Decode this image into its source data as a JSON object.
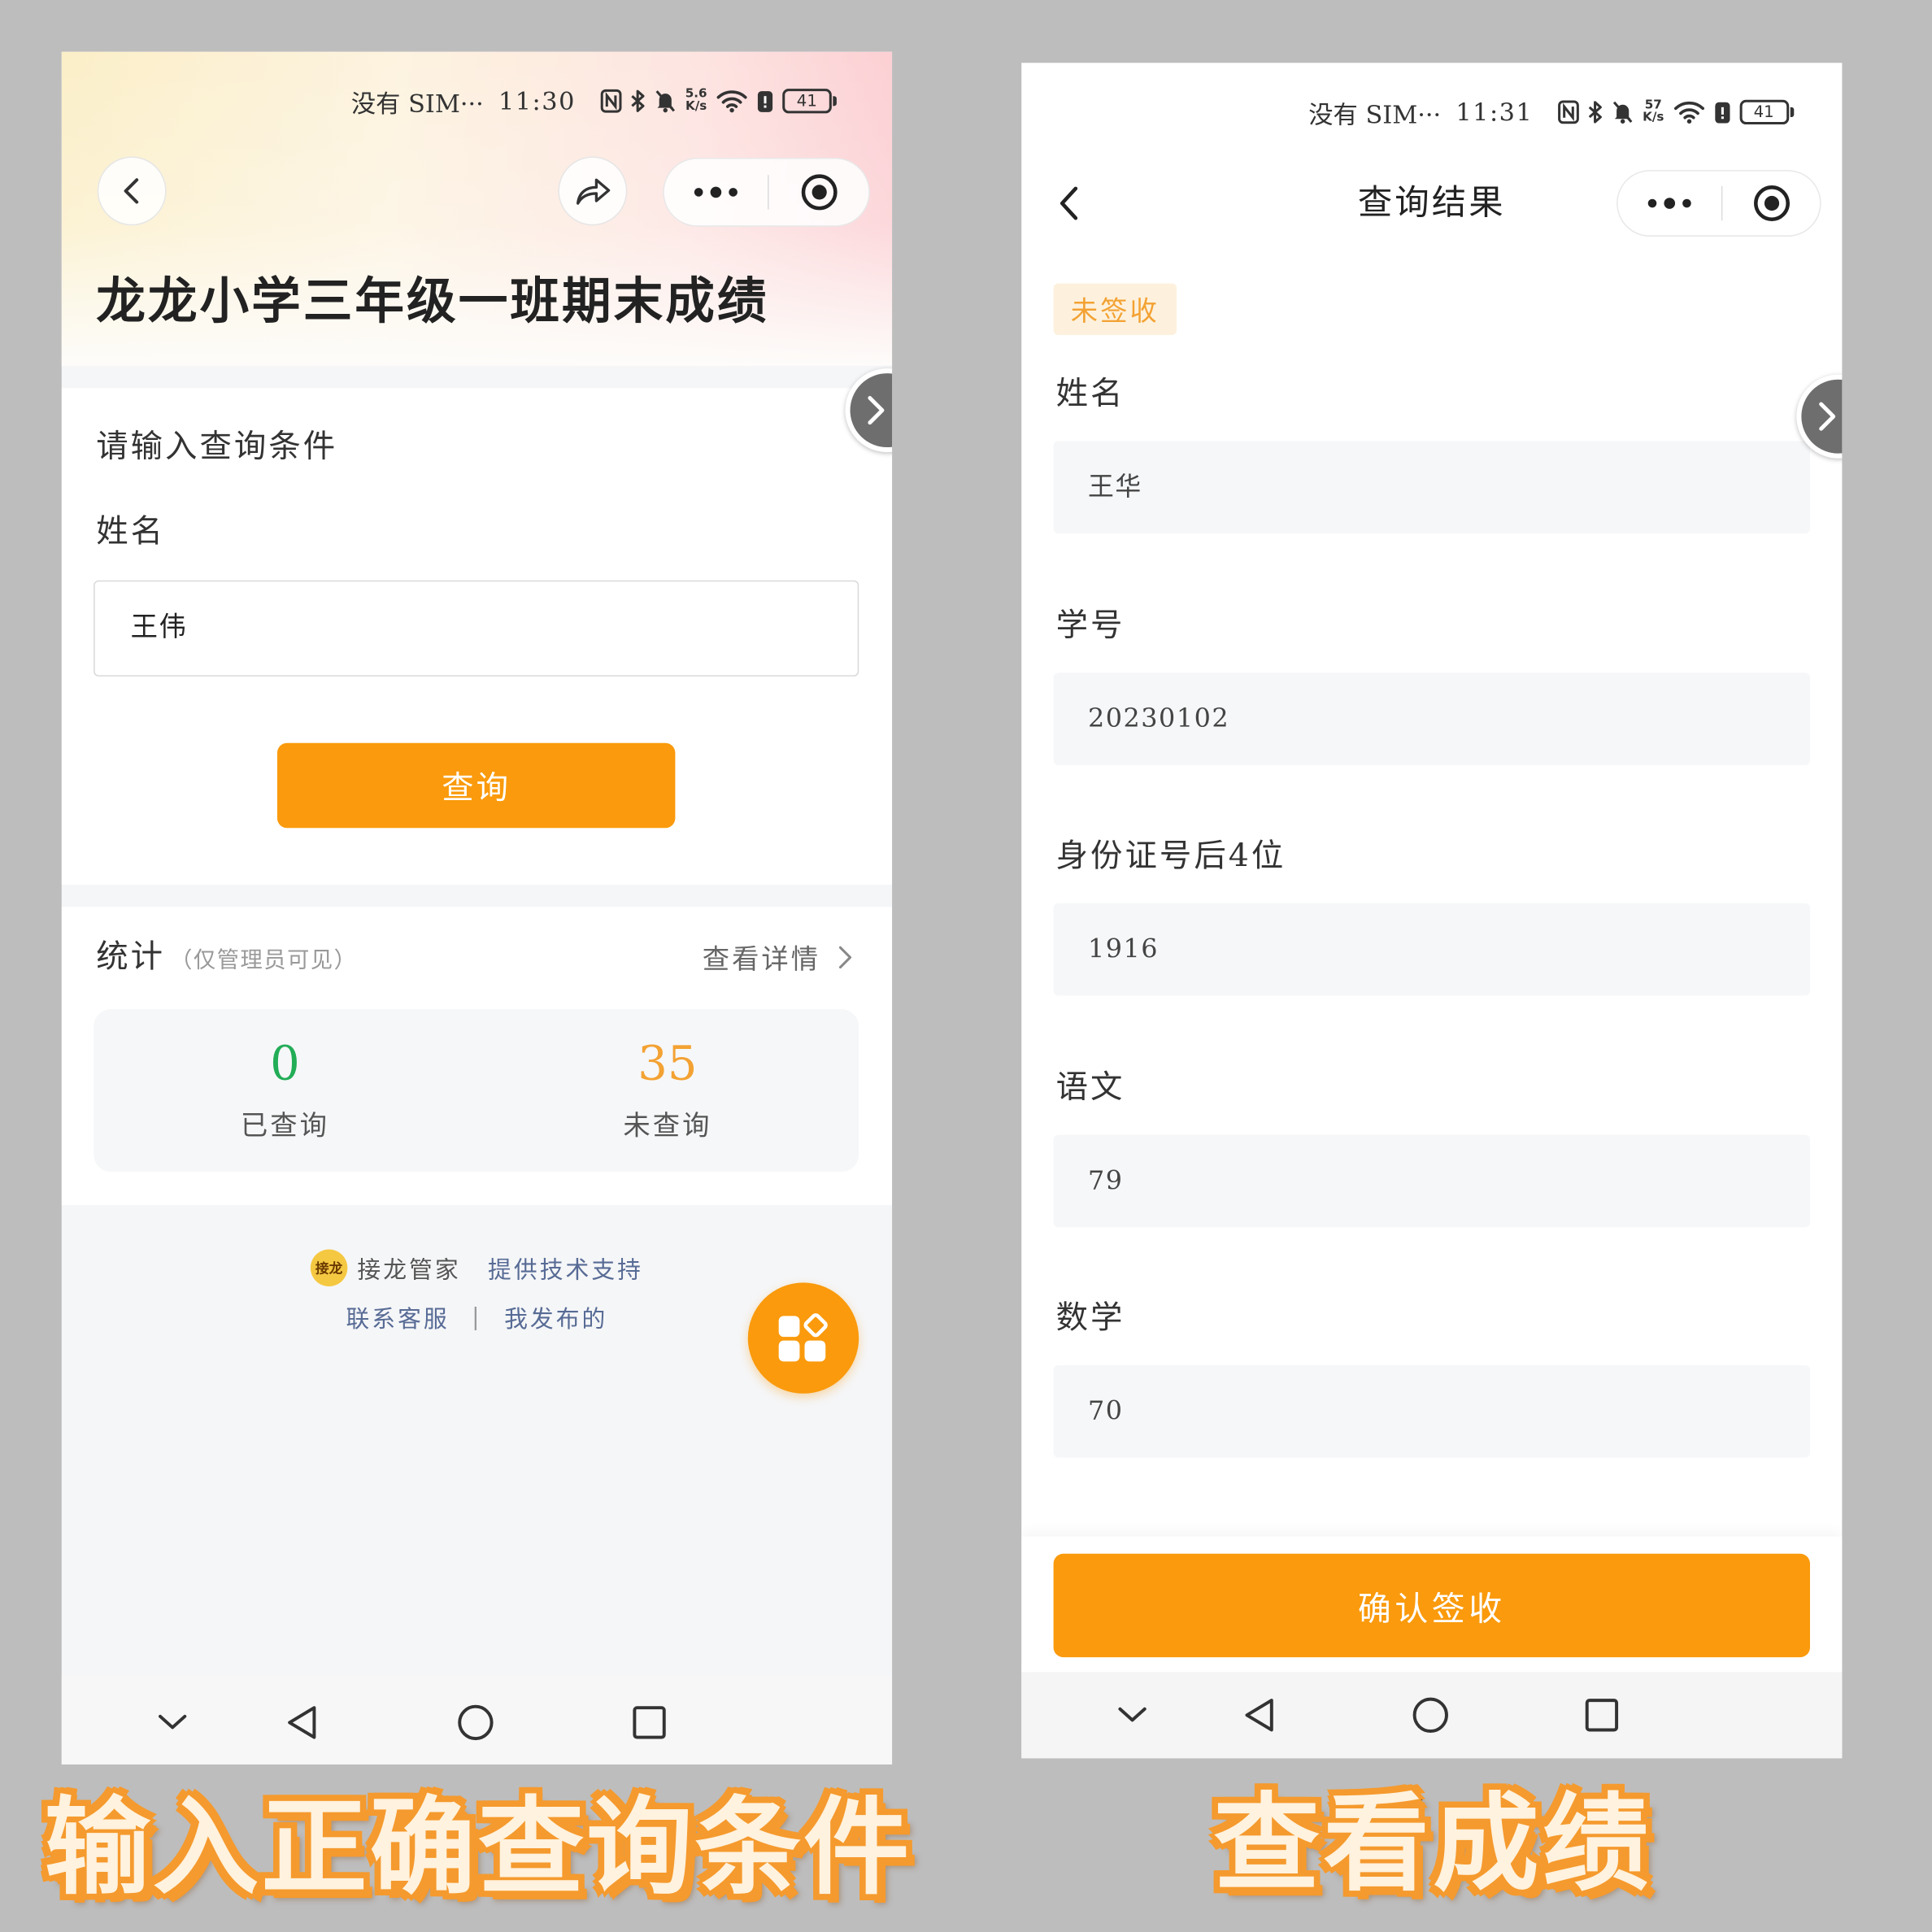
{
  "colors": {
    "page_background": "#bdbdbd",
    "accent": "#fa9a0c",
    "link": "#576b95",
    "queried_green": "#22ad57",
    "not_queried_orange": "#f3a233",
    "tag_background": "#fdf1de"
  },
  "left_screen": {
    "status_bar": {
      "carrier": "没有 SIM···",
      "time": "11:30",
      "speed_value": "5.6",
      "speed_unit": "K/s",
      "battery": "41",
      "icons": [
        "nfc-icon",
        "bluetooth-icon",
        "mute-icon",
        "wifi-icon",
        "battery-saver-icon",
        "battery-icon"
      ]
    },
    "nav_icons": [
      "back-icon",
      "share-icon",
      "more-icon",
      "target-icon"
    ],
    "page_title": "龙龙小学三年级一班期末成绩",
    "query_form": {
      "heading": "请输入查询条件",
      "name_label": "姓名",
      "name_value": "王伟",
      "submit_label": "查询"
    },
    "stats": {
      "title": "统计",
      "note": "（仅管理员可见）",
      "details_link": "查看详情",
      "queried": {
        "value": "0",
        "label": "已查询"
      },
      "not_queried": {
        "value": "35",
        "label": "未查询"
      }
    },
    "footer": {
      "logo_text": "接龙",
      "brand": "接龙管家",
      "support": "提供技术支持",
      "contact": "联系客服",
      "separator": "|",
      "my_posts": "我发布的"
    },
    "fab_icon": "apps-grid-icon",
    "system_nav_icons": [
      "chevron-down-icon",
      "back-triangle-icon",
      "home-circle-icon",
      "recents-square-icon"
    ]
  },
  "right_screen": {
    "status_bar": {
      "carrier": "没有 SIM···",
      "time": "11:31",
      "speed_value": "57",
      "speed_unit": "K/s",
      "battery": "41"
    },
    "nav_title": "查询结果",
    "status_tag": "未签收",
    "fields": [
      {
        "label": "姓名",
        "value": "王华"
      },
      {
        "label": "学号",
        "value": "20230102"
      },
      {
        "label": "身份证号后4位",
        "value": "1916"
      },
      {
        "label": "语文",
        "value": "79"
      },
      {
        "label": "数学",
        "value": "70"
      }
    ],
    "confirm_label": "确认签收"
  },
  "captions": {
    "left": "输入正确查询条件",
    "right": "查看成绩"
  }
}
